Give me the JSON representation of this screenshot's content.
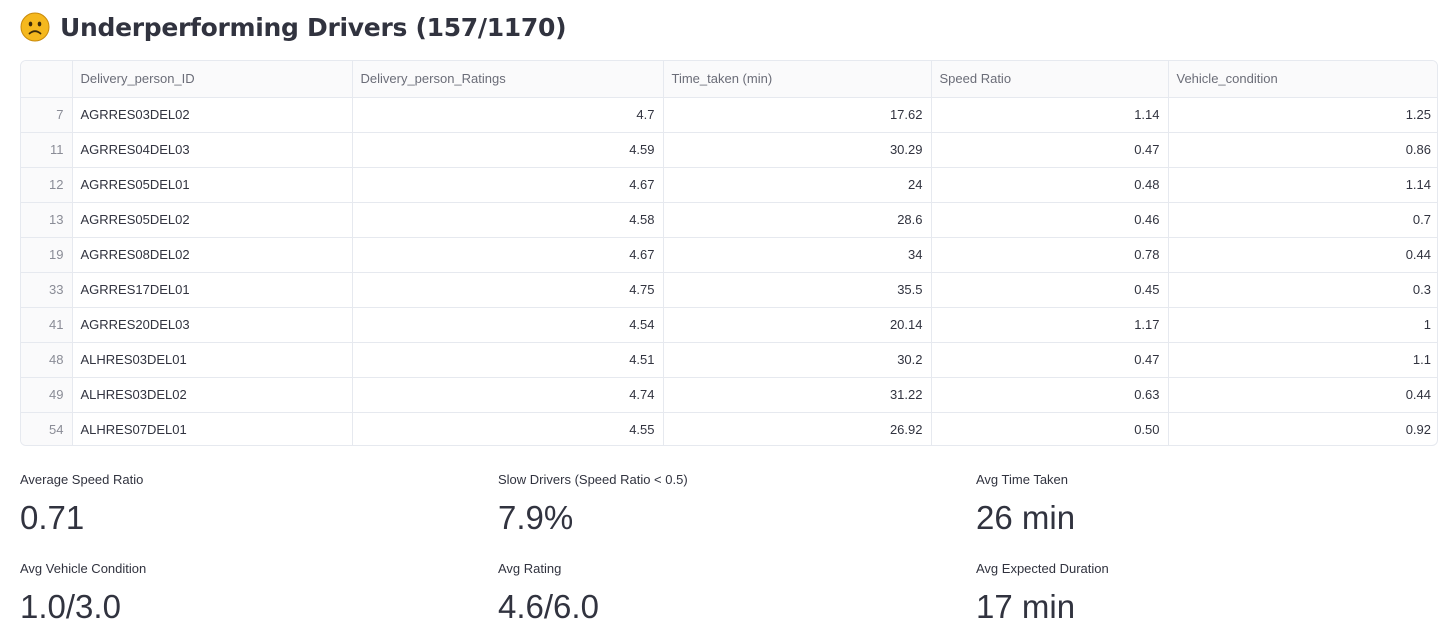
{
  "header": {
    "title": "Underperforming Drivers (157/1170)",
    "icon": "slightly-frowning-face-icon"
  },
  "table": {
    "columns": [
      "Delivery_person_ID",
      "Delivery_person_Ratings",
      "Time_taken (min)",
      "Speed Ratio",
      "Vehicle_condition"
    ],
    "rows": [
      {
        "index": "7",
        "id": "AGRRES03DEL02",
        "rating": "4.7",
        "time": "17.62",
        "speed": "1.14",
        "vehicle": "1.25"
      },
      {
        "index": "11",
        "id": "AGRRES04DEL03",
        "rating": "4.59",
        "time": "30.29",
        "speed": "0.47",
        "vehicle": "0.86"
      },
      {
        "index": "12",
        "id": "AGRRES05DEL01",
        "rating": "4.67",
        "time": "24",
        "speed": "0.48",
        "vehicle": "1.14"
      },
      {
        "index": "13",
        "id": "AGRRES05DEL02",
        "rating": "4.58",
        "time": "28.6",
        "speed": "0.46",
        "vehicle": "0.7"
      },
      {
        "index": "19",
        "id": "AGRRES08DEL02",
        "rating": "4.67",
        "time": "34",
        "speed": "0.78",
        "vehicle": "0.44"
      },
      {
        "index": "33",
        "id": "AGRRES17DEL01",
        "rating": "4.75",
        "time": "35.5",
        "speed": "0.45",
        "vehicle": "0.3"
      },
      {
        "index": "41",
        "id": "AGRRES20DEL03",
        "rating": "4.54",
        "time": "20.14",
        "speed": "1.17",
        "vehicle": "1"
      },
      {
        "index": "48",
        "id": "ALHRES03DEL01",
        "rating": "4.51",
        "time": "30.2",
        "speed": "0.47",
        "vehicle": "1.1"
      },
      {
        "index": "49",
        "id": "ALHRES03DEL02",
        "rating": "4.74",
        "time": "31.22",
        "speed": "0.63",
        "vehicle": "0.44"
      },
      {
        "index": "54",
        "id": "ALHRES07DEL01",
        "rating": "4.55",
        "time": "26.92",
        "speed": "0.50",
        "vehicle": "0.92"
      }
    ]
  },
  "metrics": [
    {
      "label": "Average Speed Ratio",
      "value": "0.71"
    },
    {
      "label": "Slow Drivers (Speed Ratio < 0.5)",
      "value": "7.9%"
    },
    {
      "label": "Avg Time Taken",
      "value": "26 min"
    },
    {
      "label": "Avg Vehicle Condition",
      "value": "1.0/3.0"
    },
    {
      "label": "Avg Rating",
      "value": "4.6/6.0"
    },
    {
      "label": "Avg Expected Duration",
      "value": "17 min"
    }
  ],
  "colors": {
    "text": "#31333f",
    "header_bg": "#fafafb",
    "border": "#e6e9ef",
    "emoji_face": "#f5b81e"
  }
}
